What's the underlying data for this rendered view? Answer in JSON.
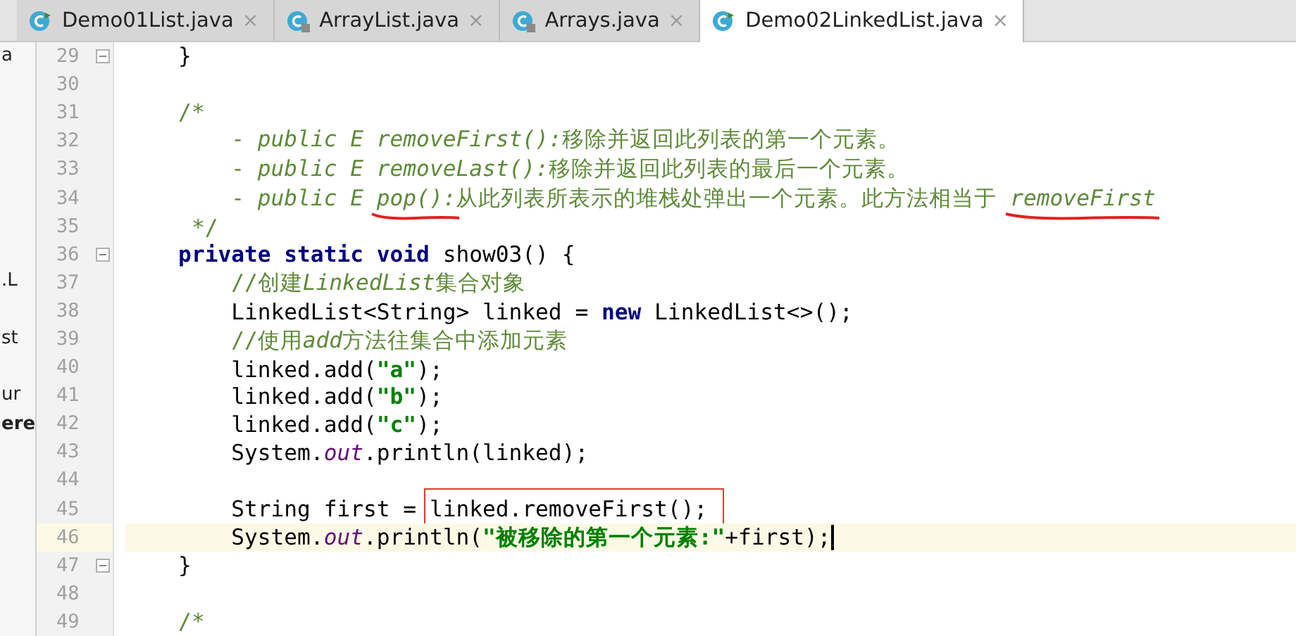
{
  "tabs": [
    {
      "label": "Demo01List.java",
      "kind": "class",
      "selected": false
    },
    {
      "label": "ArrayList.java",
      "kind": "library",
      "selected": false
    },
    {
      "label": "Arrays.java",
      "kind": "library",
      "selected": false
    },
    {
      "label": "Demo02LinkedList.java",
      "kind": "class",
      "selected": true
    }
  ],
  "tab_close": "×",
  "editor": {
    "lines": [
      {
        "number": "29",
        "side": "a",
        "foldable": true,
        "current": false,
        "tokens": [
          {
            "kind": "plain",
            "text": "    }"
          }
        ]
      },
      {
        "number": "30",
        "foldable": false,
        "current": false
      },
      {
        "number": "31",
        "foldable": false,
        "current": false,
        "tokens": [
          {
            "kind": "doc",
            "text": "    /*"
          }
        ]
      },
      {
        "number": "32",
        "foldable": false,
        "current": false,
        "tokens": [
          {
            "kind": "doc",
            "text": "        - "
          },
          {
            "kind": "doc-italic",
            "text": "public E removeFirst():"
          },
          {
            "kind": "doc",
            "text": "移除并返回此列表的第一个元素。"
          }
        ]
      },
      {
        "number": "33",
        "foldable": false,
        "current": false,
        "tokens": [
          {
            "kind": "doc",
            "text": "        - "
          },
          {
            "kind": "doc-italic",
            "text": "public E removeLast():"
          },
          {
            "kind": "doc",
            "text": "移除并返回此列表的最后一个元素。"
          }
        ]
      },
      {
        "number": "34",
        "foldable": false,
        "current": false,
        "tokens": [
          {
            "kind": "doc",
            "text": "        - "
          },
          {
            "kind": "doc-italic",
            "text": "public E "
          },
          {
            "kind": "doc-italic",
            "text": "pop():",
            "underlined": true
          },
          {
            "kind": "doc",
            "text": "从此列表所表示的堆栈处弹出一个元素。此方法相当于 "
          },
          {
            "kind": "doc-italic",
            "text": "removeFirst",
            "underlined": true
          }
        ]
      },
      {
        "number": "35",
        "foldable": false,
        "current": false,
        "tokens": [
          {
            "kind": "doc",
            "text": "     */"
          }
        ]
      },
      {
        "number": "36",
        "foldable": true,
        "current": false,
        "tokens": [
          {
            "kind": "keyword",
            "text": "    private static void "
          },
          {
            "kind": "plain",
            "text": "show03() {"
          }
        ]
      },
      {
        "number": "37",
        "side": ".L",
        "foldable": false,
        "current": false,
        "tokens": [
          {
            "kind": "comment",
            "text": "        //创建"
          },
          {
            "kind": "comment-italic",
            "text": "LinkedList"
          },
          {
            "kind": "comment",
            "text": "集合对象"
          }
        ]
      },
      {
        "number": "38",
        "foldable": false,
        "current": false,
        "tokens": [
          {
            "kind": "plain",
            "text": "        LinkedList<String> linked = "
          },
          {
            "kind": "keyword",
            "text": "new "
          },
          {
            "kind": "plain",
            "text": "LinkedList<>();"
          }
        ]
      },
      {
        "number": "39",
        "side": "st",
        "foldable": false,
        "current": false,
        "tokens": [
          {
            "kind": "comment",
            "text": "        //使用"
          },
          {
            "kind": "comment-italic",
            "text": "add"
          },
          {
            "kind": "comment",
            "text": "方法往集合中添加元素"
          }
        ]
      },
      {
        "number": "40",
        "foldable": false,
        "current": false,
        "tokens": [
          {
            "kind": "plain",
            "text": "        linked.add("
          },
          {
            "kind": "string",
            "text": "\"a\""
          },
          {
            "kind": "plain",
            "text": ");"
          }
        ]
      },
      {
        "number": "41",
        "side": "ur",
        "foldable": false,
        "current": false,
        "tokens": [
          {
            "kind": "plain",
            "text": "        linked.add("
          },
          {
            "kind": "string",
            "text": "\"b\""
          },
          {
            "kind": "plain",
            "text": ");"
          }
        ]
      },
      {
        "number": "42",
        "side": "ere",
        "foldable": false,
        "current": false,
        "tokens": [
          {
            "kind": "plain",
            "text": "        linked.add("
          },
          {
            "kind": "string",
            "text": "\"c\""
          },
          {
            "kind": "plain",
            "text": ");"
          }
        ]
      },
      {
        "number": "43",
        "foldable": false,
        "current": false,
        "tokens": [
          {
            "kind": "plain",
            "text": "        System."
          },
          {
            "kind": "field",
            "text": "out"
          },
          {
            "kind": "plain",
            "text": ".println(linked);"
          }
        ]
      },
      {
        "number": "44",
        "foldable": false,
        "current": false
      },
      {
        "number": "45",
        "foldable": false,
        "current": false,
        "tokens": [
          {
            "kind": "plain",
            "text": "        String first = "
          },
          {
            "kind": "plain",
            "text": "linked.removeFirst();",
            "boxed": true
          }
        ]
      },
      {
        "number": "46",
        "foldable": false,
        "current": true,
        "tokens": [
          {
            "kind": "plain",
            "text": "        System."
          },
          {
            "kind": "field",
            "text": "out"
          },
          {
            "kind": "plain",
            "text": ".println("
          },
          {
            "kind": "string",
            "text": "\"被移除的第一个元素:\""
          },
          {
            "kind": "plain",
            "text": "+first);"
          }
        ]
      },
      {
        "number": "47",
        "foldable": true,
        "current": false,
        "tokens": [
          {
            "kind": "plain",
            "text": "    }"
          }
        ]
      },
      {
        "number": "48",
        "foldable": false,
        "current": false
      },
      {
        "number": "49",
        "foldable": false,
        "current": false,
        "tokens": [
          {
            "kind": "doc",
            "text": "    /*"
          }
        ]
      }
    ]
  }
}
